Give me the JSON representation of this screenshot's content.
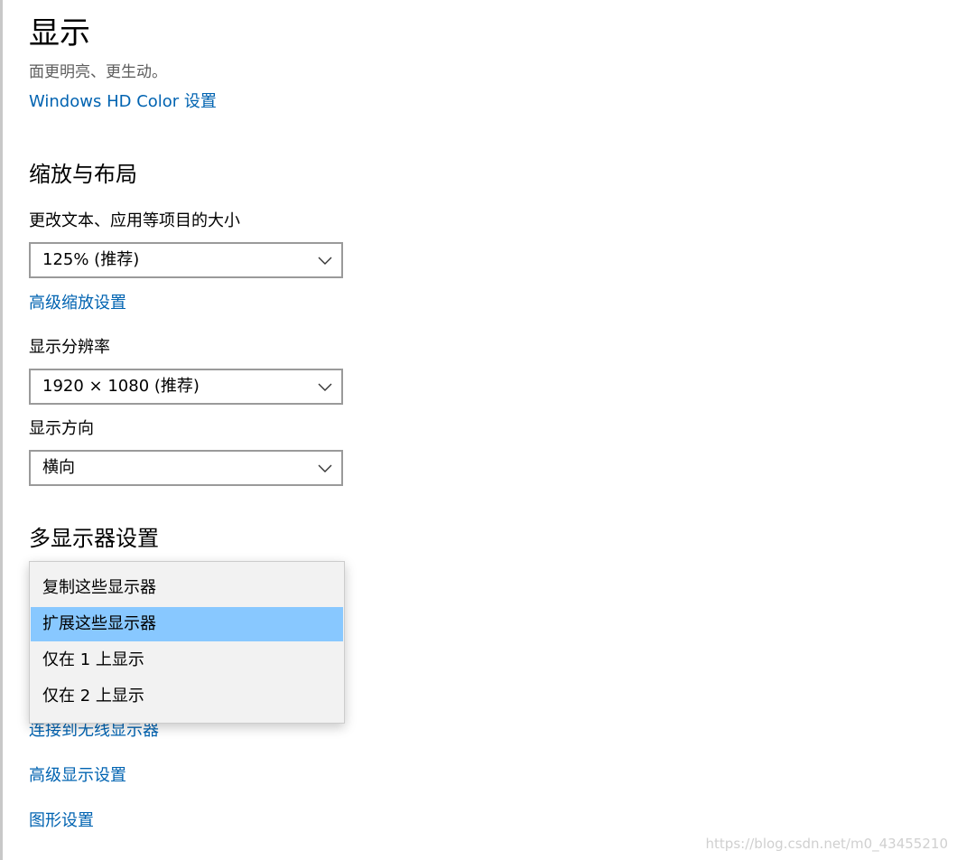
{
  "header": {
    "title": "显示",
    "subtitle": "面更明亮、更生动。",
    "hd_color_link": "Windows HD Color 设置"
  },
  "scale_layout": {
    "section_title": "缩放与布局",
    "scale_label": "更改文本、应用等项目的大小",
    "scale_value": "125% (推荐)",
    "advanced_scaling_link": "高级缩放设置",
    "resolution_label": "显示分辨率",
    "resolution_value": "1920 × 1080 (推荐)",
    "orientation_label": "显示方向",
    "orientation_value": "横向"
  },
  "multi_display": {
    "section_title": "多显示器设置",
    "options": [
      "复制这些显示器",
      "扩展这些显示器",
      "仅在 1 上显示",
      "仅在 2 上显示"
    ],
    "selected_option": "扩展这些显示器",
    "wireless_link": "连接到无线显示器",
    "advanced_display_link": "高级显示设置",
    "graphics_link": "图形设置"
  },
  "watermark": "https://blog.csdn.net/m0_43455210",
  "colors": {
    "link": "#0063b1",
    "selected_highlight": "#88c8ff",
    "dropdown_bg": "#f2f2f2"
  },
  "icons": {
    "combo_arrow": "chevron-down-icon"
  }
}
